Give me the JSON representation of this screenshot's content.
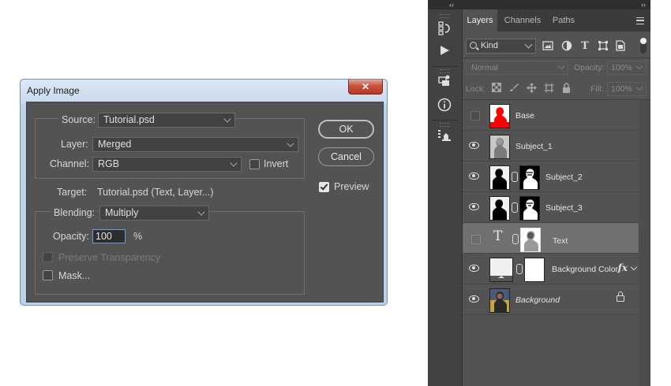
{
  "dialog": {
    "title": "Apply Image",
    "close_glyph": "✕",
    "source_label": "Source:",
    "source_value": "Tutorial.psd",
    "layer_label": "Layer:",
    "layer_value": "Merged",
    "channel_label": "Channel:",
    "channel_value": "RGB",
    "invert_label": "Invert",
    "invert_checked": false,
    "target_label": "Target:",
    "target_value": "Tutorial.psd (Text, Layer...)",
    "blending_label": "Blending:",
    "blending_value": "Multiply",
    "opacity_label": "Opacity:",
    "opacity_value": "100",
    "opacity_unit": "%",
    "preserve_label": "Preserve Transparency",
    "mask_label": "Mask...",
    "ok_label": "OK",
    "cancel_label": "Cancel",
    "preview_label": "Preview",
    "preview_checked": true
  },
  "toolbar": {
    "collapse_left": "‹‹",
    "collapse_right": "››",
    "icons": [
      "history-icon",
      "actions-play-icon",
      "properties-icon",
      "info-icon",
      "tool-presets-icon"
    ]
  },
  "layers_panel": {
    "tabs": [
      {
        "label": "Layers",
        "active": true
      },
      {
        "label": "Channels",
        "active": false
      },
      {
        "label": "Paths",
        "active": false
      }
    ],
    "filter_kind": "Kind",
    "blend_mode": "Normal",
    "opacity_label": "Opacity:",
    "opacity_value": "100%",
    "lock_label": "Lock:",
    "fill_label": "Fill:",
    "fill_value": "100%",
    "layers": [
      {
        "name": "Base",
        "visible": false,
        "selected": false,
        "thumb": "red-silhouette",
        "mask": false,
        "italic": false
      },
      {
        "name": "Subject_1",
        "visible": true,
        "selected": false,
        "thumb": "grey-portrait",
        "mask": false,
        "italic": false
      },
      {
        "name": "Subject_2",
        "visible": true,
        "selected": false,
        "thumb": "black-silhouette",
        "mask": true,
        "italic": false
      },
      {
        "name": "Subject_3",
        "visible": true,
        "selected": false,
        "thumb": "black-silhouette",
        "mask": true,
        "italic": false
      },
      {
        "name": "Text",
        "visible": false,
        "selected": true,
        "thumb": "type-layer",
        "mask": true,
        "italic": false
      },
      {
        "name": "Background Color",
        "visible": true,
        "selected": false,
        "thumb": "white-fill",
        "mask": true,
        "italic": false,
        "fx": "fx"
      },
      {
        "name": "Background",
        "visible": true,
        "selected": false,
        "thumb": "color-photo",
        "mask": false,
        "italic": true,
        "locked": true
      }
    ]
  }
}
